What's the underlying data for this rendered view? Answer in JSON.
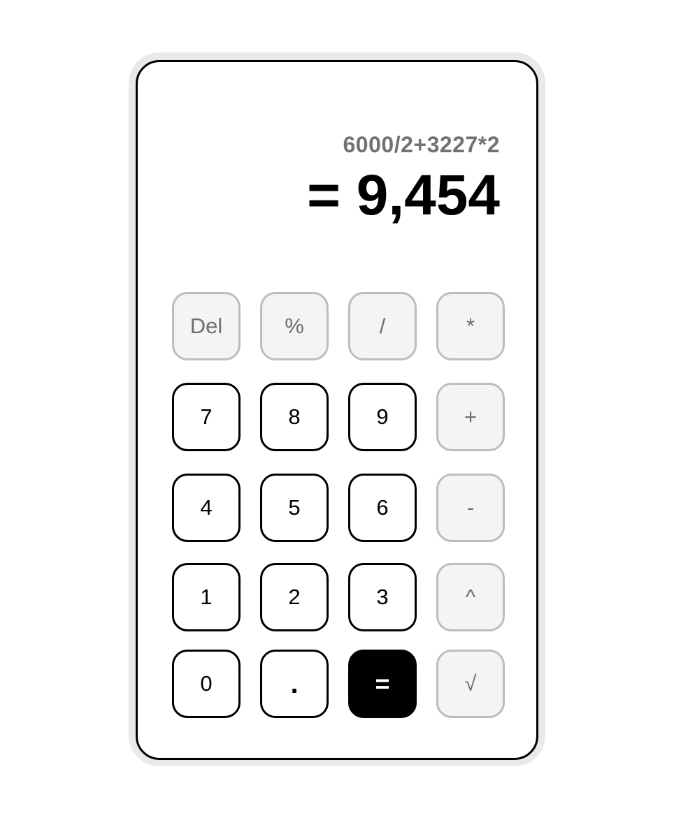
{
  "display": {
    "expression": "6000/2+3227*2",
    "result": "= 9,454"
  },
  "colors": {
    "frame": "#e9e9e9",
    "number_key_border": "#000000",
    "operator_key_bg": "#f4f4f4",
    "operator_key_border": "#bdbdbd",
    "operator_text": "#6f6f6f",
    "equals_bg": "#000000",
    "equals_text": "#ffffff"
  },
  "keys": {
    "del": "Del",
    "percent": "%",
    "divide": "/",
    "multiply": "*",
    "seven": "7",
    "eight": "8",
    "nine": "9",
    "plus": "+",
    "four": "4",
    "five": "5",
    "six": "6",
    "minus": "-",
    "one": "1",
    "two": "2",
    "three": "3",
    "power": "^",
    "zero": "0",
    "decimal": ".",
    "equals": "=",
    "sqrt": "√"
  }
}
